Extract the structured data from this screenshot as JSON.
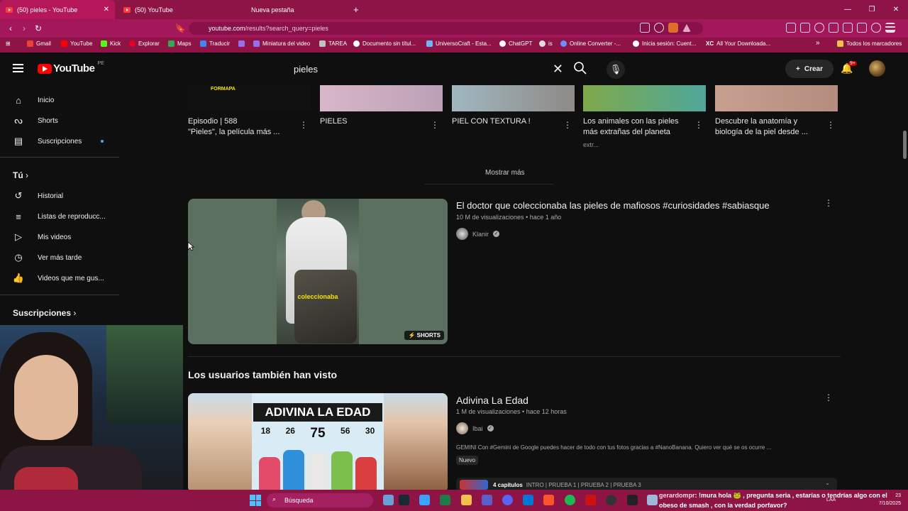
{
  "browser": {
    "tabs": [
      {
        "title": "(50) pieles - YouTube",
        "active": true
      },
      {
        "title": "(50) YouTube",
        "active": false
      },
      {
        "title": "Nueva pestaña",
        "active": false
      }
    ],
    "new_tab": "+",
    "url_host": "youtube.com",
    "url_path": "/results?search_query=pieles",
    "bookmarks": [
      "Gmail",
      "YouTube",
      "Kick",
      "Explorar",
      "Maps",
      "Traducir",
      "Miniatura del video",
      "TAREA",
      "Documento sin títul...",
      "UniversoCraft - Esta...",
      "ChatGPT",
      "is",
      "Online Converter -...",
      "Inicia sesión: Cuent...",
      "XC",
      "All Your Downloada..."
    ],
    "bookmarks_overflow": "»",
    "all_bookmarks": "Todos los marcadores"
  },
  "youtube": {
    "logo_text": "YouTube",
    "country": "PE",
    "search_value": "pieles",
    "create_label": "Crear",
    "notif_badge": "9+",
    "sidebar": {
      "main": [
        {
          "label": "Inicio",
          "icon": "home-icon"
        },
        {
          "label": "Shorts",
          "icon": "shorts-icon"
        },
        {
          "label": "Suscripciones",
          "icon": "subscriptions-icon"
        }
      ],
      "you_header": "Tú",
      "you": [
        {
          "label": "Historial",
          "icon": "history-icon"
        },
        {
          "label": "Listas de reproducc...",
          "icon": "playlist-icon"
        },
        {
          "label": "Mis videos",
          "icon": "video-icon"
        },
        {
          "label": "Ver más tarde",
          "icon": "clock-icon"
        },
        {
          "label": "Videos que me gus...",
          "icon": "like-icon"
        }
      ],
      "subs_header": "Suscripciones"
    },
    "shelf": [
      {
        "title1": "Episodio | 588",
        "title2": "\"Pieles\", la película más ...",
        "meta": "...",
        "thumb": "#1a1a1a"
      },
      {
        "title1": "PIELES",
        "title2": "",
        "meta": "...",
        "thumb": "#d8b7c9"
      },
      {
        "title1": "PIEL CON TEXTURA !",
        "title2": "",
        "meta": "...",
        "thumb": "#8e8a86"
      },
      {
        "title1": "Los animales con las pieles",
        "title2": "más extrañas del planeta",
        "meta": "extr...",
        "thumb": "#6fae7a"
      },
      {
        "title1": "Descubre la anatomía y",
        "title2": "biología de la piel desde ...",
        "meta": "...",
        "thumb": "#c89f90"
      }
    ],
    "show_more": "Mostrar más",
    "video1": {
      "title": "El doctor que coleccionaba las pieles de mafiosos #curiosidades #sabiasque",
      "views": "10 M de visualizaciones",
      "age": "hace 1 año",
      "channel": "Klanir",
      "caption": "coleccionaba",
      "badge": "SHORTS"
    },
    "section_title": "Los usuarios también han visto",
    "video2": {
      "title": "Adivina La Edad",
      "views": "1 M de visualizaciones",
      "age": "hace 12 horas",
      "channel": "Ibai",
      "banner": "ADIVINA LA EDAD",
      "numbers": [
        "18",
        "26",
        "75",
        "56",
        "30"
      ],
      "description": "GEMINI Con #Gemini de Google puedes hacer de todo con tus fotos gracias a #NanoBanana. Quiero ver qué se os ocurre ...",
      "badge": "Nuevo",
      "chapters_label": "4 capítulos",
      "chapters": "INTRO | PRUEBA 1 | PRUEBA 2 | PRUEBA 3"
    }
  },
  "taskbar": {
    "search_placeholder": "Búsqueda",
    "chat_user": "gerardompr",
    "chat_message": ": !mura hola 🐸 , pregunta seria , estarías o tendrías algo con el obeso de smash , con la verdad porfavor?",
    "time": "23",
    "date": "7/10/2025",
    "lang": "LAA"
  },
  "colors": {
    "browser_chrome": "#8e1446",
    "yt_bg": "#0f0f0f",
    "yt_red": "#ff0000",
    "accent_blue": "#3ea6ff"
  }
}
